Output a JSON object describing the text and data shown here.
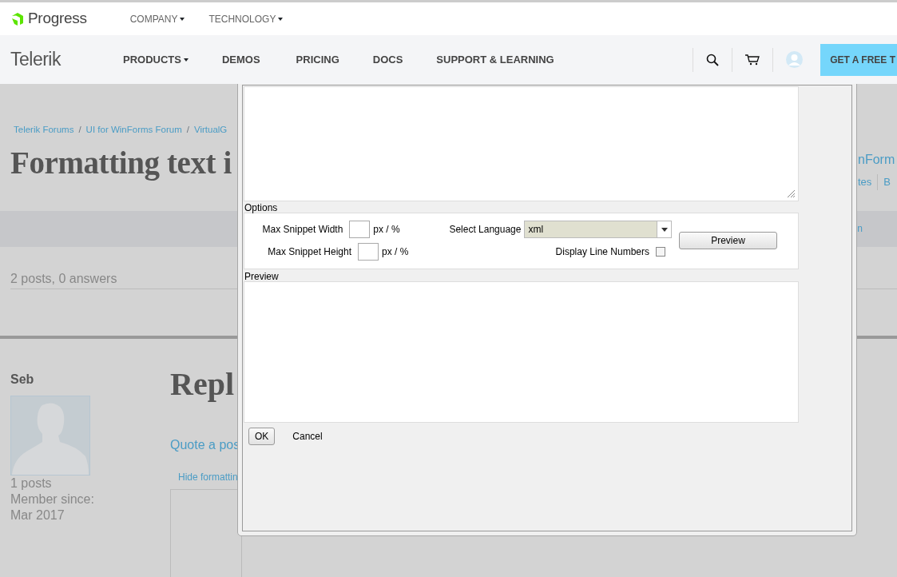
{
  "header": {
    "brand": "Progress",
    "top_nav": [
      {
        "label": "COMPANY",
        "dropdown": true
      },
      {
        "label": "TECHNOLOGY",
        "dropdown": true
      }
    ],
    "product": "Telerik",
    "main_nav": [
      {
        "label": "PRODUCTS",
        "dropdown": true
      },
      {
        "label": "DEMOS",
        "dropdown": false
      },
      {
        "label": "PRICING",
        "dropdown": false
      },
      {
        "label": "DOCS",
        "dropdown": false
      },
      {
        "label": "SUPPORT & LEARNING",
        "dropdown": false
      }
    ],
    "cta": "GET A FREE T"
  },
  "page": {
    "breadcrumb": [
      "Telerik Forums",
      "UI for WinForms Forum",
      "VirtualG"
    ],
    "separator": "/",
    "title": "Formatting text i",
    "title_right": "nForm",
    "right_links": [
      "tes",
      "B"
    ],
    "bar_text": "n",
    "stats": "2 posts, 0 answers",
    "author": {
      "name": "Seb",
      "posts": "1 posts",
      "member_since_label": "Member since:",
      "member_since": "Mar 2017"
    },
    "reply": {
      "heading": "Repl",
      "quote_link": "Quote a pos",
      "formatting_link": "Hide formattin"
    }
  },
  "dialog": {
    "options": {
      "legend": "Options",
      "width_label": "Max Snippet Width",
      "width_unit": "px / %",
      "height_label": "Max Snippet Height",
      "height_unit": "px / %",
      "language_label": "Select Language",
      "language": "xml",
      "line_numbers_label": "Display Line Numbers",
      "line_numbers": false,
      "preview_button": "Preview"
    },
    "preview": {
      "legend": "Preview"
    },
    "buttons": [
      {
        "label": "OK",
        "kind": "button"
      },
      {
        "label": "Cancel",
        "kind": "link"
      }
    ]
  }
}
